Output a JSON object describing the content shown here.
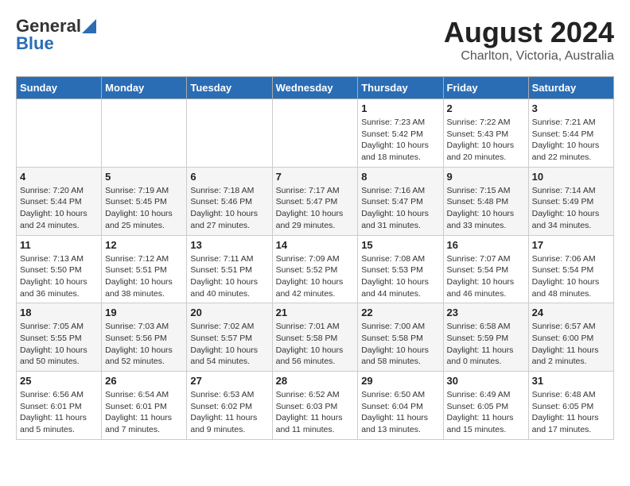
{
  "header": {
    "logo_general": "General",
    "logo_blue": "Blue",
    "month_year": "August 2024",
    "location": "Charlton, Victoria, Australia"
  },
  "weekdays": [
    "Sunday",
    "Monday",
    "Tuesday",
    "Wednesday",
    "Thursday",
    "Friday",
    "Saturday"
  ],
  "weeks": [
    [
      {
        "day": "",
        "info": ""
      },
      {
        "day": "",
        "info": ""
      },
      {
        "day": "",
        "info": ""
      },
      {
        "day": "",
        "info": ""
      },
      {
        "day": "1",
        "info": "Sunrise: 7:23 AM\nSunset: 5:42 PM\nDaylight: 10 hours\nand 18 minutes."
      },
      {
        "day": "2",
        "info": "Sunrise: 7:22 AM\nSunset: 5:43 PM\nDaylight: 10 hours\nand 20 minutes."
      },
      {
        "day": "3",
        "info": "Sunrise: 7:21 AM\nSunset: 5:44 PM\nDaylight: 10 hours\nand 22 minutes."
      }
    ],
    [
      {
        "day": "4",
        "info": "Sunrise: 7:20 AM\nSunset: 5:44 PM\nDaylight: 10 hours\nand 24 minutes."
      },
      {
        "day": "5",
        "info": "Sunrise: 7:19 AM\nSunset: 5:45 PM\nDaylight: 10 hours\nand 25 minutes."
      },
      {
        "day": "6",
        "info": "Sunrise: 7:18 AM\nSunset: 5:46 PM\nDaylight: 10 hours\nand 27 minutes."
      },
      {
        "day": "7",
        "info": "Sunrise: 7:17 AM\nSunset: 5:47 PM\nDaylight: 10 hours\nand 29 minutes."
      },
      {
        "day": "8",
        "info": "Sunrise: 7:16 AM\nSunset: 5:47 PM\nDaylight: 10 hours\nand 31 minutes."
      },
      {
        "day": "9",
        "info": "Sunrise: 7:15 AM\nSunset: 5:48 PM\nDaylight: 10 hours\nand 33 minutes."
      },
      {
        "day": "10",
        "info": "Sunrise: 7:14 AM\nSunset: 5:49 PM\nDaylight: 10 hours\nand 34 minutes."
      }
    ],
    [
      {
        "day": "11",
        "info": "Sunrise: 7:13 AM\nSunset: 5:50 PM\nDaylight: 10 hours\nand 36 minutes."
      },
      {
        "day": "12",
        "info": "Sunrise: 7:12 AM\nSunset: 5:51 PM\nDaylight: 10 hours\nand 38 minutes."
      },
      {
        "day": "13",
        "info": "Sunrise: 7:11 AM\nSunset: 5:51 PM\nDaylight: 10 hours\nand 40 minutes."
      },
      {
        "day": "14",
        "info": "Sunrise: 7:09 AM\nSunset: 5:52 PM\nDaylight: 10 hours\nand 42 minutes."
      },
      {
        "day": "15",
        "info": "Sunrise: 7:08 AM\nSunset: 5:53 PM\nDaylight: 10 hours\nand 44 minutes."
      },
      {
        "day": "16",
        "info": "Sunrise: 7:07 AM\nSunset: 5:54 PM\nDaylight: 10 hours\nand 46 minutes."
      },
      {
        "day": "17",
        "info": "Sunrise: 7:06 AM\nSunset: 5:54 PM\nDaylight: 10 hours\nand 48 minutes."
      }
    ],
    [
      {
        "day": "18",
        "info": "Sunrise: 7:05 AM\nSunset: 5:55 PM\nDaylight: 10 hours\nand 50 minutes."
      },
      {
        "day": "19",
        "info": "Sunrise: 7:03 AM\nSunset: 5:56 PM\nDaylight: 10 hours\nand 52 minutes."
      },
      {
        "day": "20",
        "info": "Sunrise: 7:02 AM\nSunset: 5:57 PM\nDaylight: 10 hours\nand 54 minutes."
      },
      {
        "day": "21",
        "info": "Sunrise: 7:01 AM\nSunset: 5:58 PM\nDaylight: 10 hours\nand 56 minutes."
      },
      {
        "day": "22",
        "info": "Sunrise: 7:00 AM\nSunset: 5:58 PM\nDaylight: 10 hours\nand 58 minutes."
      },
      {
        "day": "23",
        "info": "Sunrise: 6:58 AM\nSunset: 5:59 PM\nDaylight: 11 hours\nand 0 minutes."
      },
      {
        "day": "24",
        "info": "Sunrise: 6:57 AM\nSunset: 6:00 PM\nDaylight: 11 hours\nand 2 minutes."
      }
    ],
    [
      {
        "day": "25",
        "info": "Sunrise: 6:56 AM\nSunset: 6:01 PM\nDaylight: 11 hours\nand 5 minutes."
      },
      {
        "day": "26",
        "info": "Sunrise: 6:54 AM\nSunset: 6:01 PM\nDaylight: 11 hours\nand 7 minutes."
      },
      {
        "day": "27",
        "info": "Sunrise: 6:53 AM\nSunset: 6:02 PM\nDaylight: 11 hours\nand 9 minutes."
      },
      {
        "day": "28",
        "info": "Sunrise: 6:52 AM\nSunset: 6:03 PM\nDaylight: 11 hours\nand 11 minutes."
      },
      {
        "day": "29",
        "info": "Sunrise: 6:50 AM\nSunset: 6:04 PM\nDaylight: 11 hours\nand 13 minutes."
      },
      {
        "day": "30",
        "info": "Sunrise: 6:49 AM\nSunset: 6:05 PM\nDaylight: 11 hours\nand 15 minutes."
      },
      {
        "day": "31",
        "info": "Sunrise: 6:48 AM\nSunset: 6:05 PM\nDaylight: 11 hours\nand 17 minutes."
      }
    ]
  ]
}
